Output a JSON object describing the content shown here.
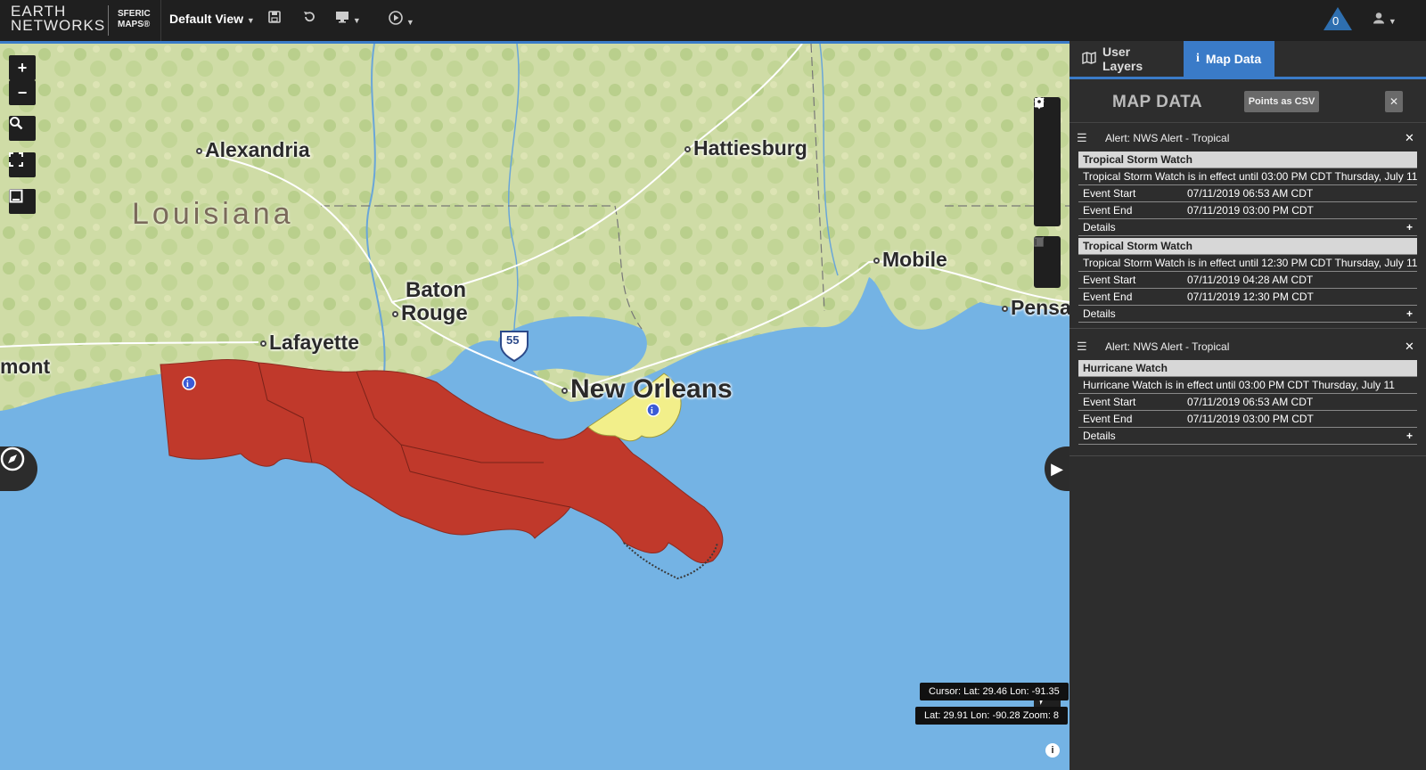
{
  "app": {
    "logo_line1": "EARTH",
    "logo_line2": "NETWORKS",
    "product_line1": "SFERIC",
    "product_line2": "MAPS®",
    "view_label": "Default View",
    "alert_count": "0"
  },
  "map": {
    "cities": [
      "Alexandria",
      "Hattiesburg",
      "Baton",
      "Rouge",
      "Lafayette",
      "New Orleans",
      "Mobile",
      "Pensa",
      "mont"
    ],
    "state_label": "Louisiana",
    "highway": "55",
    "cursor_readout": "Cursor: Lat: 29.46 Lon: -91.35",
    "center_readout": "Lat: 29.91 Lon: -90.28 Zoom: 8",
    "alert_colors": {
      "tropical_storm": "#c0392b",
      "hurricane": "#f2ef8a"
    }
  },
  "panel": {
    "tabs": [
      "User Layers",
      "Map Data"
    ],
    "title": "MAP DATA",
    "csv_button": "Points as CSV",
    "alerts": [
      {
        "header": "Alert: NWS Alert - Tropical",
        "watches": [
          {
            "title": "Tropical Storm Watch",
            "summary": "Tropical Storm Watch is in effect until 03:00 PM CDT Thursday, July 11",
            "event_start_label": "Event Start",
            "event_start": "07/11/2019 06:53 AM CDT",
            "event_end_label": "Event End",
            "event_end": "07/11/2019 03:00 PM CDT",
            "details_label": "Details"
          },
          {
            "title": "Tropical Storm Watch",
            "summary": "Tropical Storm Watch is in effect until 12:30 PM CDT Thursday, July 11",
            "event_start_label": "Event Start",
            "event_start": "07/11/2019 04:28 AM CDT",
            "event_end_label": "Event End",
            "event_end": "07/11/2019 12:30 PM CDT",
            "details_label": "Details"
          }
        ]
      },
      {
        "header": "Alert: NWS Alert - Tropical",
        "watches": [
          {
            "title": "Hurricane Watch",
            "summary": "Hurricane Watch is in effect until 03:00 PM CDT Thursday, July 11",
            "event_start_label": "Event Start",
            "event_start": "07/11/2019 06:53 AM CDT",
            "event_end_label": "Event End",
            "event_end": "07/11/2019 03:00 PM CDT",
            "details_label": "Details"
          }
        ]
      }
    ]
  },
  "icons": [
    "save-icon",
    "undo-icon",
    "monitor-icon",
    "play-icon",
    "user-icon",
    "zoom-in-icon",
    "zoom-out-icon",
    "search-zoom-icon",
    "fullscreen-icon",
    "select-area-icon",
    "line-draw-icon",
    "polygon-draw-icon",
    "rectangle-draw-icon",
    "circle-draw-icon",
    "marker-draw-icon",
    "edit-icon",
    "trash-icon",
    "compass-icon",
    "expand-arrow-icon",
    "locate-icon",
    "info-icon",
    "map-icon",
    "close-icon",
    "menu-icon",
    "plus-icon"
  ]
}
